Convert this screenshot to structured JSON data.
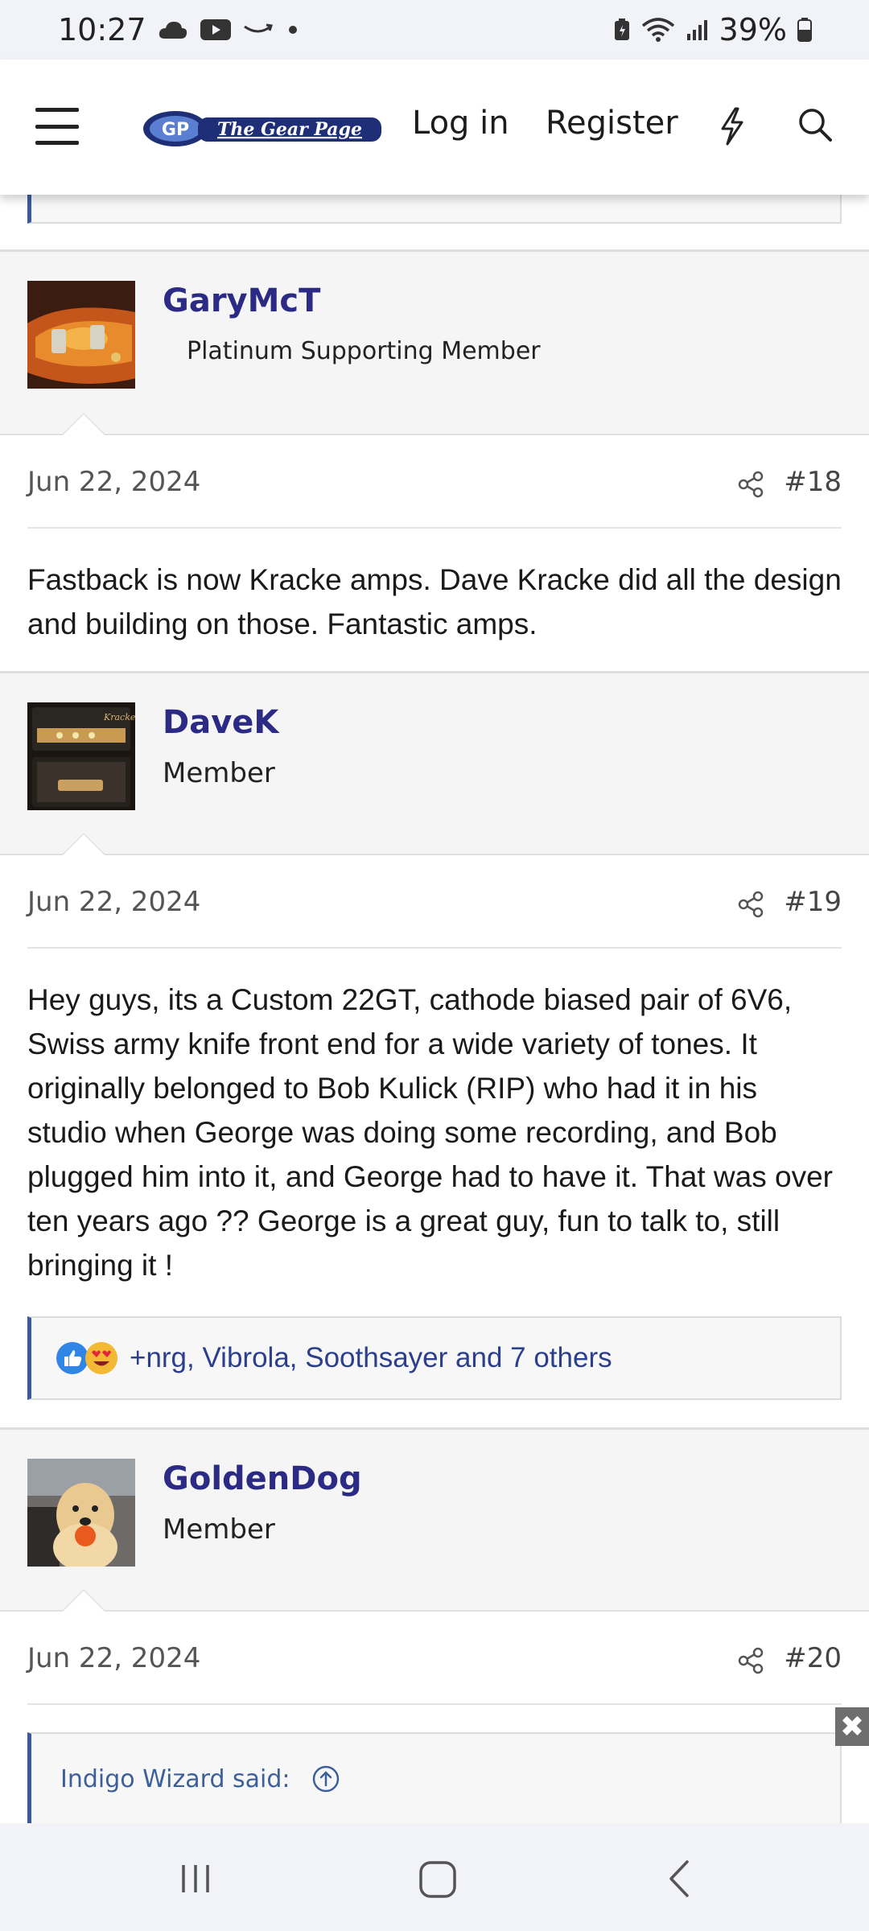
{
  "status_bar": {
    "time": "10:27",
    "battery": "39%",
    "icons": [
      "cloud-icon",
      "youtube-icon",
      "amazon-icon",
      "dot-icon",
      "battery-saver-icon",
      "wifi-icon",
      "signal-icon",
      "battery-icon"
    ]
  },
  "header": {
    "logo_alt": "The Gear Page",
    "login_label": "Log in",
    "register_label": "Register",
    "icons": [
      "menu-icon",
      "bolt-icon",
      "search-icon"
    ]
  },
  "posts": [
    {
      "username": "GaryMcT",
      "user_title": "Platinum Supporting Member",
      "date": "Jun 22, 2024",
      "number": "#18",
      "body": "Fastback is now Kracke amps. Dave Kracke did all the design and building on those. Fantastic amps."
    },
    {
      "username": "DaveK",
      "user_title": "Member",
      "date": "Jun 22, 2024",
      "number": "#19",
      "body": "Hey guys, its a Custom 22GT, cathode biased pair of 6V6, Swiss army knife front end for a wide variety of tones. It originally belonged to Bob Kulick (RIP) who had it in his studio when George was doing some recording, and Bob plugged him into it, and George had to have it. That was over ten years ago ?? George is a great guy, fun to talk to, still bringing it !",
      "reactions": "+nrg, Vibrola, Soothsayer and 7 others"
    },
    {
      "username": "GoldenDog",
      "user_title": "Member",
      "date": "Jun 22, 2024",
      "number": "#20",
      "quote_label": "Indigo Wizard said:"
    }
  ],
  "colors": {
    "username": "#2b2b86",
    "quote_border": "#3a5a9a",
    "link": "#2b3f8c"
  },
  "close_button": "✖"
}
